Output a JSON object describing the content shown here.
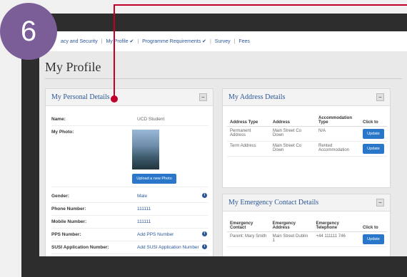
{
  "badge": "6",
  "nav": {
    "items": [
      "acy and Security",
      "My Profile ✔",
      "Programme Requirements ✔",
      "Survey",
      "Fees"
    ],
    "separator": "|"
  },
  "page_title": "My Profile",
  "personal": {
    "title": "My Personal Details",
    "collapse": "−",
    "rows": [
      {
        "label": "Name:",
        "value": "UCD Student"
      },
      {
        "label": "My Photo:",
        "value": ""
      },
      {
        "label": "Gender:",
        "value": "Male"
      },
      {
        "label": "Phone Number:",
        "value": "111111"
      },
      {
        "label": "Mobile Number:",
        "value": "111111"
      },
      {
        "label": "PPS Number:",
        "value": "Add PPS Number"
      },
      {
        "label": "SUSI Application Number:",
        "value": "Add SUSI Application Number"
      }
    ],
    "upload_label": "Upload a new Photo"
  },
  "address": {
    "title": "My Address Details",
    "collapse": "−",
    "headers": [
      "Address Type",
      "Address",
      "Accommodation Type",
      "Click to"
    ],
    "rows": [
      {
        "type": "Permanent Address",
        "address": "Main Street Co Down",
        "accom": "N/A",
        "action": "Update"
      },
      {
        "type": "Term Address",
        "address": "Main Street Co Down",
        "accom": "Rented Accommodation",
        "action": "Update"
      }
    ]
  },
  "emergency": {
    "title": "My Emergency Contact Details",
    "collapse": "−",
    "headers": [
      "Emergency Contact",
      "Emergency Address",
      "Emergency Telephone",
      "Click to"
    ],
    "rows": [
      {
        "contact": "Parent: Mary Smith",
        "address": "Main Street Dublin 1",
        "phone": "+44 111111 746",
        "action": "Update"
      }
    ]
  },
  "colors": {
    "accent": "#2a77c9",
    "badge": "#7b5e97",
    "callout": "#c0002a",
    "link": "#2b5797"
  }
}
